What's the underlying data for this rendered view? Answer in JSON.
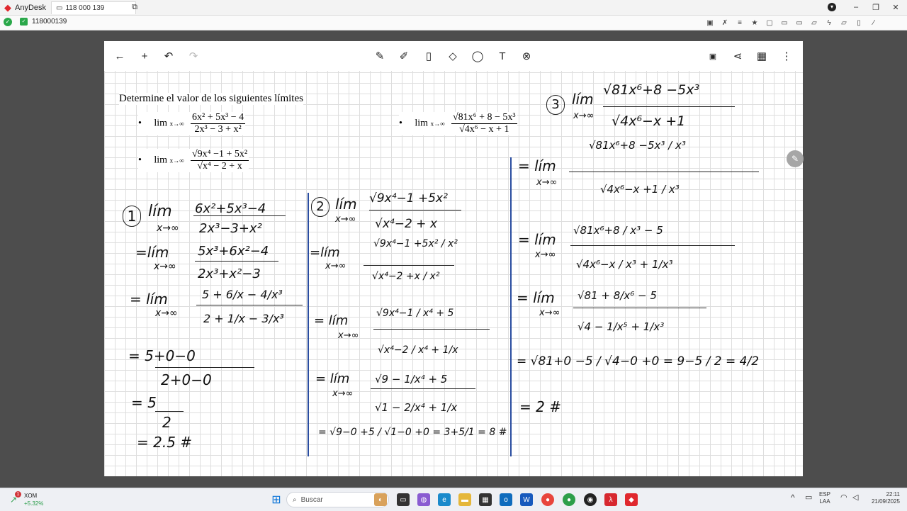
{
  "app": {
    "name": "AnyDesk",
    "session_tab": "118 000 139",
    "address": "118000139"
  },
  "toolbar_right_icons": [
    "screen-icon",
    "wrench-icon",
    "layers-icon",
    "star-icon",
    "file-icon",
    "display-icon",
    "chat-icon",
    "speech-icon",
    "lightning-icon",
    "chat-bubble-icon",
    "note-icon",
    "edit-icon"
  ],
  "notes_toolbar": {
    "tools": [
      "back-arrow-icon",
      "plus-icon",
      "undo-icon",
      "redo-icon",
      "pen-icon",
      "marker-icon",
      "highlighter-icon",
      "eraser-icon",
      "lasso-icon",
      "text-icon",
      "cancel-icon"
    ],
    "right": [
      "a-box-icon",
      "share-icon",
      "grid-icon",
      "more-icon"
    ]
  },
  "problem": {
    "title": "Determine el valor de los siguientes límites",
    "bullets": [
      {
        "lim": "lim",
        "sub": "x→∞",
        "num": "6x² + 5x³ − 4",
        "den": "2x³ − 3 + x²"
      },
      {
        "lim": "lim",
        "sub": "x→∞",
        "num": "√9x⁴ −1 + 5x²",
        "den": "√x⁴ − 2 + x"
      },
      {
        "lim": "lim",
        "sub": "x→∞",
        "num": "√81x⁶ + 8 − 5x³",
        "den": "√4x⁶ − x + 1"
      }
    ]
  },
  "handwriting": {
    "col1": {
      "label": "1",
      "step1": {
        "lim": "lím",
        "sub": "x→∞",
        "num": "6x²+5x³−4",
        "den": "2x³−3+x²"
      },
      "step2": {
        "lim": "=lím",
        "sub": "x→∞",
        "num": "5x³+6x²−4",
        "den": "2x³+x²−3"
      },
      "step3": {
        "lim": "= lím",
        "sub": "x→∞",
        "num": "5 + 6/x − 4/x³",
        "den": "2 + 1/x − 3/x³"
      },
      "step4": {
        "num": "= 5+0−0",
        "den": "2+0−0"
      },
      "step5": {
        "num": "= 5",
        "den": "2"
      },
      "result": "= 2.5 #"
    },
    "col2": {
      "label": "2",
      "step1": {
        "lim": "lím",
        "sub": "x→∞",
        "num": "√9x⁴−1 +5x²",
        "den": "√x⁴−2 + x"
      },
      "step2": {
        "lim": "=lím",
        "sub": "x→∞",
        "num": "√9x⁴−1 +5x² / x²",
        "den": "√x⁴−2 +x / x²"
      },
      "step3": {
        "lim": "= lím",
        "sub": "x→∞",
        "num": "√9x⁴−1 / x⁴ + 5",
        "den": "√x⁴−2 / x⁴ + 1/x"
      },
      "step4": {
        "lim": "= lím",
        "sub": "x→∞",
        "num": "√9 − 1/x⁴ + 5",
        "den": "√1 − 2/x⁴ + 1/x"
      },
      "result": "= √9−0 +5 / √1−0 +0 = 3+5/1 = 8 #"
    },
    "col3": {
      "label": "3",
      "step1": {
        "lim": "lím",
        "sub": "x→∞",
        "num": "√81x⁶+8 −5x³",
        "den": "√4x⁶−x +1"
      },
      "step2": {
        "lim": "= lím",
        "sub": "x→∞",
        "num": "√81x⁶+8 −5x³ / x³",
        "den": "√4x⁶−x +1 / x³"
      },
      "step3": {
        "lim": "= lím",
        "sub": "x→∞",
        "num": "√81x⁶+8 / x³ − 5",
        "den": "√4x⁶−x / x³ + 1/x³"
      },
      "step4": {
        "lim": "= lím",
        "sub": "x→∞",
        "num": "√81 + 8/x⁶ − 5",
        "den": "√4 − 1/x⁵ + 1/x³"
      },
      "step5": "= √81+0 −5 / √4−0 +0 = 9−5 / 2 = 4/2",
      "result": "= 2 #"
    }
  },
  "taskbar": {
    "stock": {
      "ticker": "XOM",
      "change": "+5.32%",
      "badge": "1"
    },
    "search_placeholder": "Buscar",
    "lang": "ESP",
    "lang_sub": "LAA",
    "time": "22:11",
    "date": "21/09/2025"
  }
}
